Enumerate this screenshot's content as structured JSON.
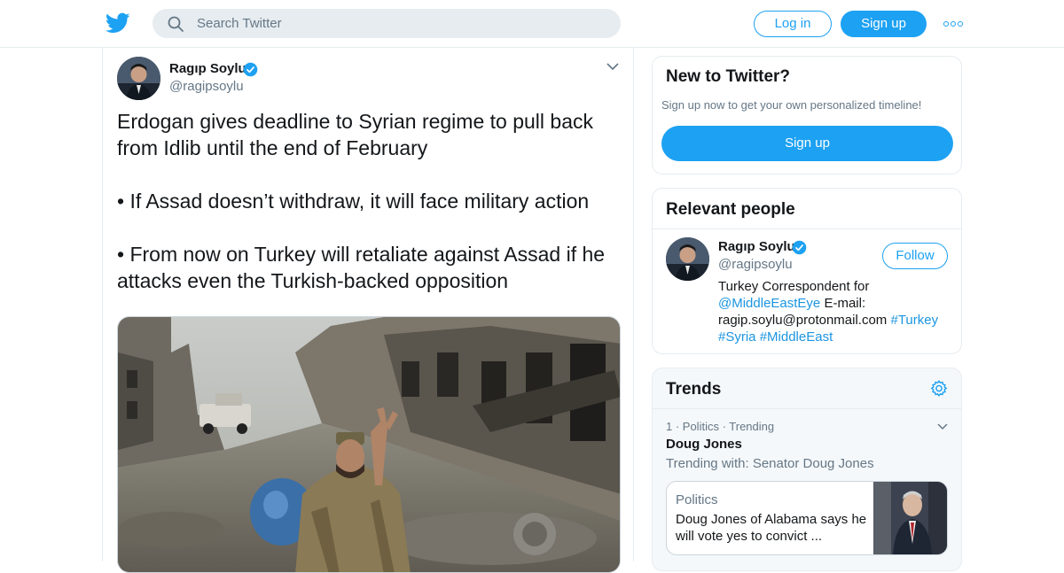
{
  "header": {
    "logo_icon": "twitter-bird-icon",
    "search_placeholder": "Search Twitter",
    "login_label": "Log in",
    "signup_label": "Sign up",
    "more_icon": "more-dots-icon",
    "brand_color": "#1da1f2"
  },
  "tweet": {
    "author_name": "Ragıp Soylu",
    "author_handle": "@ragipsoylu",
    "verified_icon": "verified-badge-icon",
    "paragraphs": [
      "Erdogan gives deadline to Syrian regime to pull back from Idlib until the end of February",
      "• If Assad doesn’t withdraw, it will face military action",
      "• From now on Turkey will retaliate against Assad if he attacks even the Turkish-backed opposition"
    ],
    "media_icon": "tweet-photo"
  },
  "new_to_twitter": {
    "title": "New to Twitter?",
    "subtitle": "Sign up now to get your own personalized timeline!",
    "signup_label": "Sign up"
  },
  "relevant_people": {
    "title": "Relevant people",
    "name": "Ragıp Soylu",
    "handle": "@ragipsoylu",
    "follow_label": "Follow",
    "bio": {
      "text1": "Turkey Correspondent for ",
      "mention": "@MiddleEastEye",
      "text2": " E-mail: ragip.soylu@protonmail.com ",
      "tag1": "#Turkey",
      "tag2": "#Syria",
      "tag3": "#MiddleEast"
    }
  },
  "trends": {
    "title": "Trends",
    "settings_icon": "gear-icon",
    "items": [
      {
        "meta": "1 · Politics · Trending",
        "topic": "Doug Jones",
        "with": "Trending with: Senator Doug Jones",
        "news_category": "Politics",
        "news_headline": "Doug Jones of Alabama says he will vote yes to convict ..."
      }
    ]
  }
}
